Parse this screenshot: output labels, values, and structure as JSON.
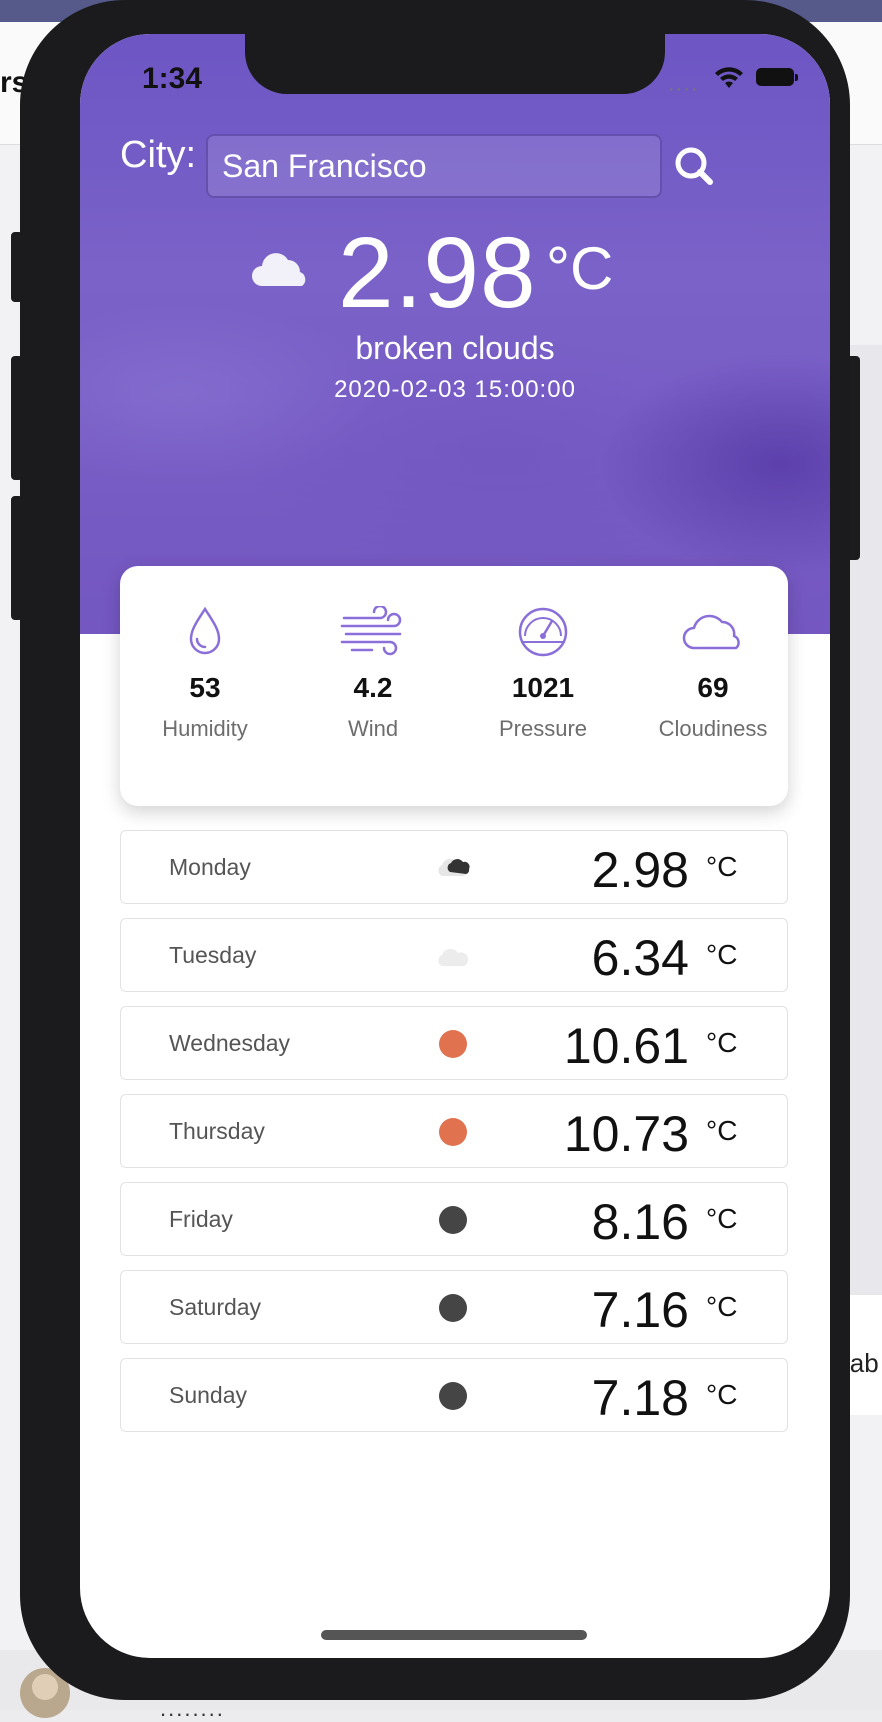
{
  "background": {
    "header_text": "rst",
    "right_text": "lab",
    "bottom_text": "........"
  },
  "status_bar": {
    "time": "1:34",
    "signal": "····"
  },
  "search": {
    "label": "City:",
    "value": "San Francisco"
  },
  "current": {
    "temperature": "2.98",
    "unit": "°C",
    "description": "broken clouds",
    "datetime": "2020-02-03 15:00:00",
    "icon": "cloud-icon"
  },
  "stats": [
    {
      "value": "53",
      "label": "Humidity",
      "icon": "humidity-drop-icon"
    },
    {
      "value": "4.2",
      "label": "Wind",
      "icon": "wind-icon"
    },
    {
      "value": "1021",
      "label": "Pressure",
      "icon": "pressure-gauge-icon"
    },
    {
      "value": "69",
      "label": "Cloudiness",
      "icon": "cloud-outline-icon"
    }
  ],
  "forecast": [
    {
      "day": "Monday",
      "temp": "2.98",
      "unit": "°C",
      "icon": "broken-clouds-icon"
    },
    {
      "day": "Tuesday",
      "temp": "6.34",
      "unit": "°C",
      "icon": "light-cloud-icon"
    },
    {
      "day": "Wednesday",
      "temp": "10.61",
      "unit": "°C",
      "icon": "sun-dot-icon"
    },
    {
      "day": "Thursday",
      "temp": "10.73",
      "unit": "°C",
      "icon": "sun-dot-icon"
    },
    {
      "day": "Friday",
      "temp": "8.16",
      "unit": "°C",
      "icon": "dark-dot-icon"
    },
    {
      "day": "Saturday",
      "temp": "7.16",
      "unit": "°C",
      "icon": "dark-dot-icon"
    },
    {
      "day": "Sunday",
      "temp": "7.18",
      "unit": "°C",
      "icon": "dark-dot-icon"
    }
  ],
  "colors": {
    "accent": "#7a62c8",
    "icon_purple": "#8b6fd9",
    "sun_dot": "#e07250",
    "dark_dot": "#454545"
  }
}
